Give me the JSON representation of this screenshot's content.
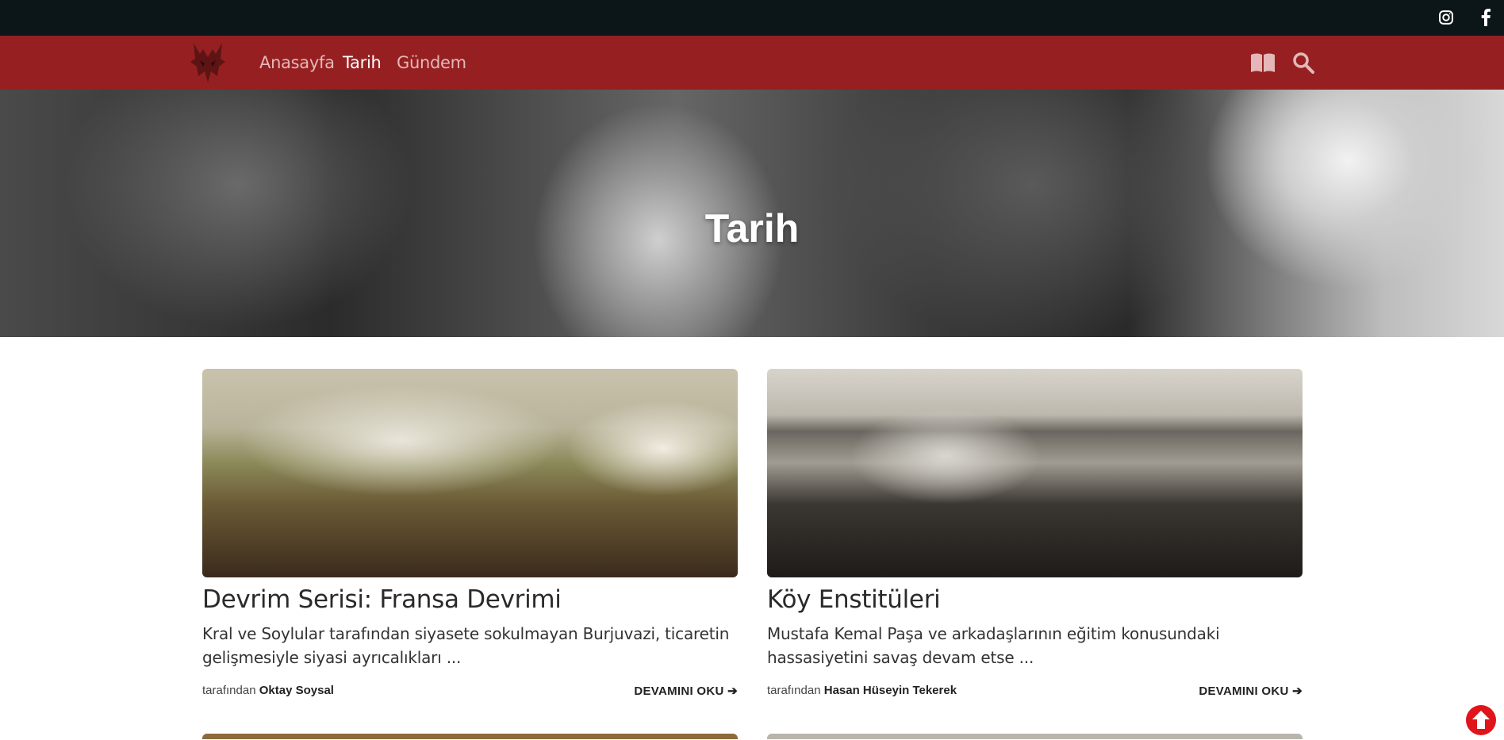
{
  "nav": {
    "home": "Anasayfa",
    "history": "Tarih",
    "agenda": "Gündem"
  },
  "icons": {
    "topbar": [
      "instagram-icon",
      "facebook-icon"
    ],
    "navbar": [
      "logo",
      "book-icon",
      "search-icon"
    ],
    "floating": "arrow-up-circle-icon"
  },
  "hero": {
    "title": "Tarih"
  },
  "articles": [
    {
      "title": "Devrim Serisi: Fransa Devrimi",
      "excerpt": "Kral ve Soylular tarafından siyasete sokulmayan Burjuvazi, ticaretin gelişmesiyle siyasi ayrıcalıkları ...",
      "by": "tarafından",
      "author": "Oktay Soysal",
      "read_more": "DEVAMINI OKU"
    },
    {
      "title": "Köy Enstitüleri",
      "excerpt": "Mustafa Kemal Paşa ve arkadaşlarının eğitim konusundaki hassasiyetini savaş devam etse ...",
      "by": "tarafından",
      "author": "Hasan Hüseyin Tekerek",
      "read_more": "DEVAMINI OKU"
    }
  ],
  "colors": {
    "topbar": "#0c1618",
    "navbar": "#962021",
    "scroll_top": "#e0141b"
  }
}
